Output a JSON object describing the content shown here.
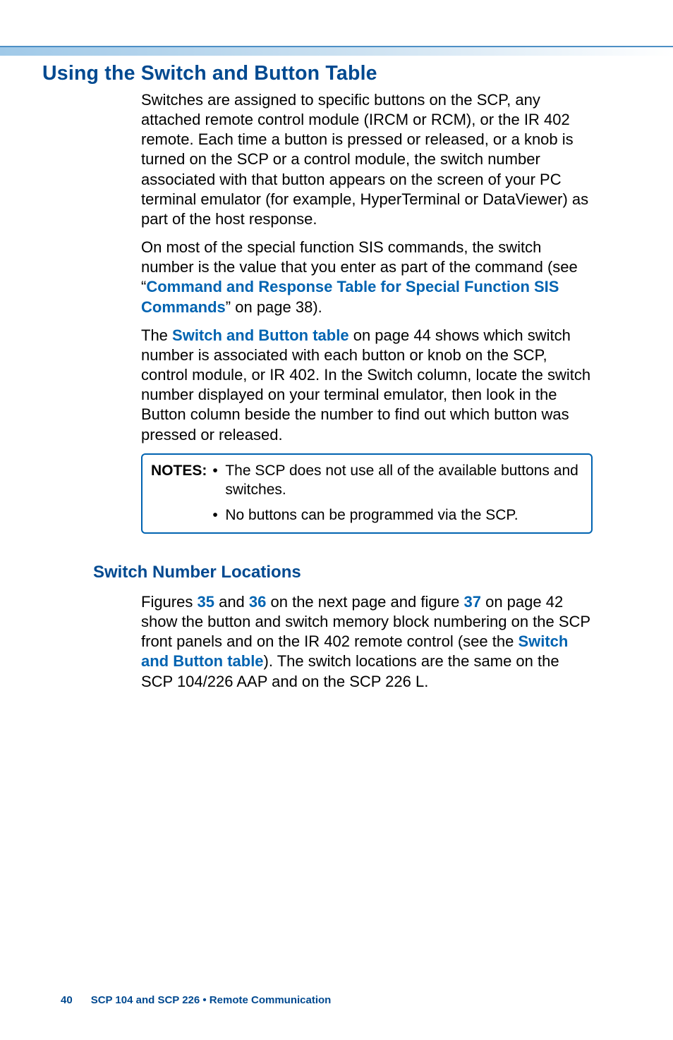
{
  "section_title": "Using the Switch and Button Table",
  "para1": "Switches are assigned to specific buttons on the SCP, any attached remote control module (IRCM or RCM), or the IR 402 remote. Each time a button is pressed or released, or a knob is turned on the SCP or a control module, the switch number associated with that button appears on the screen of your PC terminal emulator (for example, HyperTerminal or DataViewer) as part of the host response.",
  "para2_pre": "On most of the special function SIS commands, the switch number is the value that you enter as part of the command (see “",
  "para2_link": "Command and Response Table for Special Function SIS Commands",
  "para2_post": "” on page 38).",
  "para3_pre": "The ",
  "para3_link": "Switch and Button table",
  "para3_post": " on page 44 shows which switch number is associated with each button or knob on the SCP, control module, or IR 402. In the Switch column, locate the switch number displayed on your terminal emulator, then look in the Button column beside the number to find out which button was pressed or released.",
  "notes_label": "NOTES:",
  "notes": [
    "The SCP does not use all of the available buttons and switches.",
    "No buttons can be programmed via the SCP."
  ],
  "sub_title": "Switch Number Locations",
  "para4_pre": "Figures ",
  "para4_l1": "35",
  "para4_mid1": " and ",
  "para4_l2": "36",
  "para4_mid2": " on the next page and figure ",
  "para4_l3": "37",
  "para4_mid3": " on page 42 show the button and switch memory block numbering on the SCP front panels and on the IR 402 remote control (see the ",
  "para4_l4": "Switch and Button table",
  "para4_post": "). The switch locations are the same on the SCP 104/226 AAP and on the SCP 226 L.",
  "footer_page": "40",
  "footer_text": "SCP 104 and SCP 226 • Remote Communication"
}
